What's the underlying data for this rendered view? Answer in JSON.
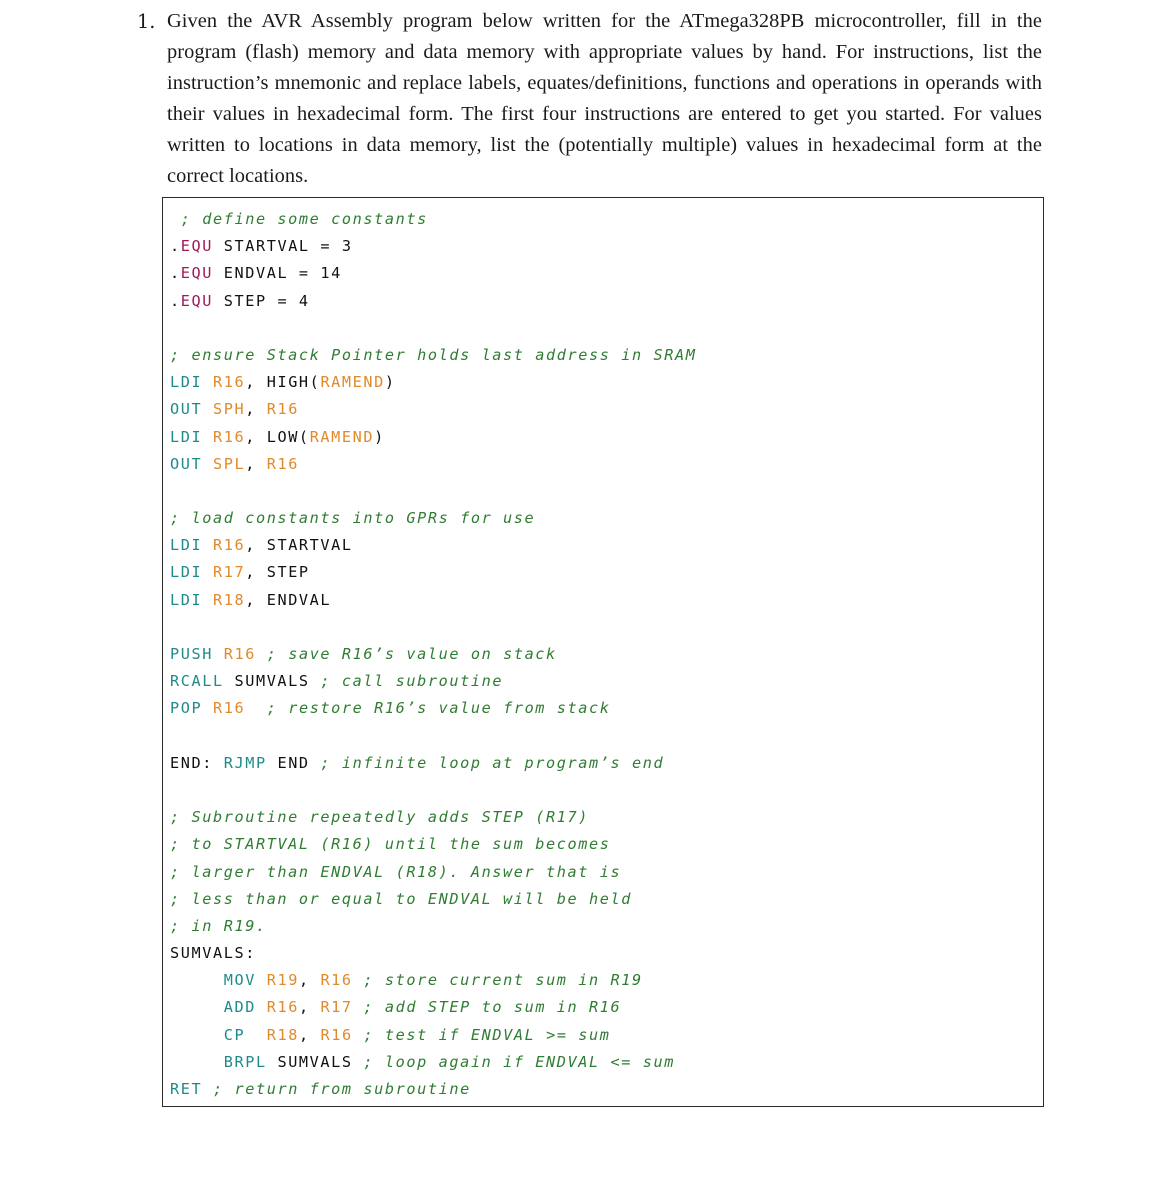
{
  "question": {
    "number": "1.",
    "text": "Given the AVR Assembly program below written for the ATmega328PB microcontroller, fill in the program (flash) memory and data memory with appropriate values by hand. For instructions, list the instruction’s mnemonic and replace labels, equates/definitions, functions and operations in operands with their values in hexadecimal form. The first four instructions are entered to get you started. For values written to locations in data memory, list the (potentially multiple) values in hexadecimal form at the correct locations."
  },
  "colors": {
    "directive": "#a0185a",
    "instruction": "#1f8a8a",
    "register": "#e08a2a",
    "comment": "#2f7d32",
    "text": "#111111"
  },
  "code": {
    "lines": [
      [
        {
          "t": "comment",
          "v": " ; define some constants"
        }
      ],
      [
        {
          "t": "plain",
          "v": "."
        },
        {
          "t": "dir",
          "v": "EQU"
        },
        {
          "t": "plain",
          "v": " STARTVAL = 3"
        }
      ],
      [
        {
          "t": "plain",
          "v": "."
        },
        {
          "t": "dir",
          "v": "EQU"
        },
        {
          "t": "plain",
          "v": " ENDVAL = 14"
        }
      ],
      [
        {
          "t": "plain",
          "v": "."
        },
        {
          "t": "dir",
          "v": "EQU"
        },
        {
          "t": "plain",
          "v": " STEP = 4"
        }
      ],
      [],
      [
        {
          "t": "comment",
          "v": "; ensure Stack Pointer holds last address in SRAM"
        }
      ],
      [
        {
          "t": "inst",
          "v": "LDI"
        },
        {
          "t": "plain",
          "v": " "
        },
        {
          "t": "reg",
          "v": "R16"
        },
        {
          "t": "plain",
          "v": ", HIGH("
        },
        {
          "t": "reg",
          "v": "RAMEND"
        },
        {
          "t": "plain",
          "v": ")"
        }
      ],
      [
        {
          "t": "inst",
          "v": "OUT"
        },
        {
          "t": "plain",
          "v": " "
        },
        {
          "t": "reg",
          "v": "SPH"
        },
        {
          "t": "plain",
          "v": ", "
        },
        {
          "t": "reg",
          "v": "R16"
        }
      ],
      [
        {
          "t": "inst",
          "v": "LDI"
        },
        {
          "t": "plain",
          "v": " "
        },
        {
          "t": "reg",
          "v": "R16"
        },
        {
          "t": "plain",
          "v": ", LOW("
        },
        {
          "t": "reg",
          "v": "RAMEND"
        },
        {
          "t": "plain",
          "v": ")"
        }
      ],
      [
        {
          "t": "inst",
          "v": "OUT"
        },
        {
          "t": "plain",
          "v": " "
        },
        {
          "t": "reg",
          "v": "SPL"
        },
        {
          "t": "plain",
          "v": ", "
        },
        {
          "t": "reg",
          "v": "R16"
        }
      ],
      [],
      [
        {
          "t": "comment",
          "v": "; load constants into GPRs for use"
        }
      ],
      [
        {
          "t": "inst",
          "v": "LDI"
        },
        {
          "t": "plain",
          "v": " "
        },
        {
          "t": "reg",
          "v": "R16"
        },
        {
          "t": "plain",
          "v": ", STARTVAL"
        }
      ],
      [
        {
          "t": "inst",
          "v": "LDI"
        },
        {
          "t": "plain",
          "v": " "
        },
        {
          "t": "reg",
          "v": "R17"
        },
        {
          "t": "plain",
          "v": ", STEP"
        }
      ],
      [
        {
          "t": "inst",
          "v": "LDI"
        },
        {
          "t": "plain",
          "v": " "
        },
        {
          "t": "reg",
          "v": "R18"
        },
        {
          "t": "plain",
          "v": ", ENDVAL"
        }
      ],
      [],
      [
        {
          "t": "inst",
          "v": "PUSH"
        },
        {
          "t": "plain",
          "v": " "
        },
        {
          "t": "reg",
          "v": "R16"
        },
        {
          "t": "plain",
          "v": " "
        },
        {
          "t": "comment",
          "v": "; save R16’s value on stack"
        }
      ],
      [
        {
          "t": "inst",
          "v": "RCALL"
        },
        {
          "t": "plain",
          "v": " SUMVALS "
        },
        {
          "t": "comment",
          "v": "; call subroutine"
        }
      ],
      [
        {
          "t": "inst",
          "v": "POP"
        },
        {
          "t": "plain",
          "v": " "
        },
        {
          "t": "reg",
          "v": "R16"
        },
        {
          "t": "plain",
          "v": "  "
        },
        {
          "t": "comment",
          "v": "; restore R16’s value from stack"
        }
      ],
      [],
      [
        {
          "t": "plain",
          "v": "END: "
        },
        {
          "t": "inst",
          "v": "RJMP"
        },
        {
          "t": "plain",
          "v": " END "
        },
        {
          "t": "comment",
          "v": "; infinite loop at program’s end"
        }
      ],
      [],
      [
        {
          "t": "comment",
          "v": "; Subroutine repeatedly adds STEP (R17)"
        }
      ],
      [
        {
          "t": "comment",
          "v": "; to STARTVAL (R16) until the sum becomes"
        }
      ],
      [
        {
          "t": "comment",
          "v": "; larger than ENDVAL (R18). Answer that is"
        }
      ],
      [
        {
          "t": "comment",
          "v": "; less than or equal to ENDVAL will be held"
        }
      ],
      [
        {
          "t": "comment",
          "v": "; in R19."
        }
      ],
      [
        {
          "t": "plain",
          "v": "SUMVALS:"
        }
      ],
      [
        {
          "t": "plain",
          "v": "     "
        },
        {
          "t": "inst",
          "v": "MOV"
        },
        {
          "t": "plain",
          "v": " "
        },
        {
          "t": "reg",
          "v": "R19"
        },
        {
          "t": "plain",
          "v": ", "
        },
        {
          "t": "reg",
          "v": "R16"
        },
        {
          "t": "plain",
          "v": " "
        },
        {
          "t": "comment",
          "v": "; store current sum in R19"
        }
      ],
      [
        {
          "t": "plain",
          "v": "     "
        },
        {
          "t": "inst",
          "v": "ADD"
        },
        {
          "t": "plain",
          "v": " "
        },
        {
          "t": "reg",
          "v": "R16"
        },
        {
          "t": "plain",
          "v": ", "
        },
        {
          "t": "reg",
          "v": "R17"
        },
        {
          "t": "plain",
          "v": " "
        },
        {
          "t": "comment",
          "v": "; add STEP to sum in R16"
        }
      ],
      [
        {
          "t": "plain",
          "v": "     "
        },
        {
          "t": "inst",
          "v": "CP"
        },
        {
          "t": "plain",
          "v": "  "
        },
        {
          "t": "reg",
          "v": "R18"
        },
        {
          "t": "plain",
          "v": ", "
        },
        {
          "t": "reg",
          "v": "R16"
        },
        {
          "t": "plain",
          "v": " "
        },
        {
          "t": "comment",
          "v": "; test if ENDVAL >= sum"
        }
      ],
      [
        {
          "t": "plain",
          "v": "     "
        },
        {
          "t": "inst",
          "v": "BRPL"
        },
        {
          "t": "plain",
          "v": " SUMVALS "
        },
        {
          "t": "comment",
          "v": "; loop again if ENDVAL <= sum"
        }
      ],
      [
        {
          "t": "inst",
          "v": "RET"
        },
        {
          "t": "plain",
          "v": " "
        },
        {
          "t": "comment",
          "v": "; return from subroutine"
        }
      ]
    ]
  }
}
